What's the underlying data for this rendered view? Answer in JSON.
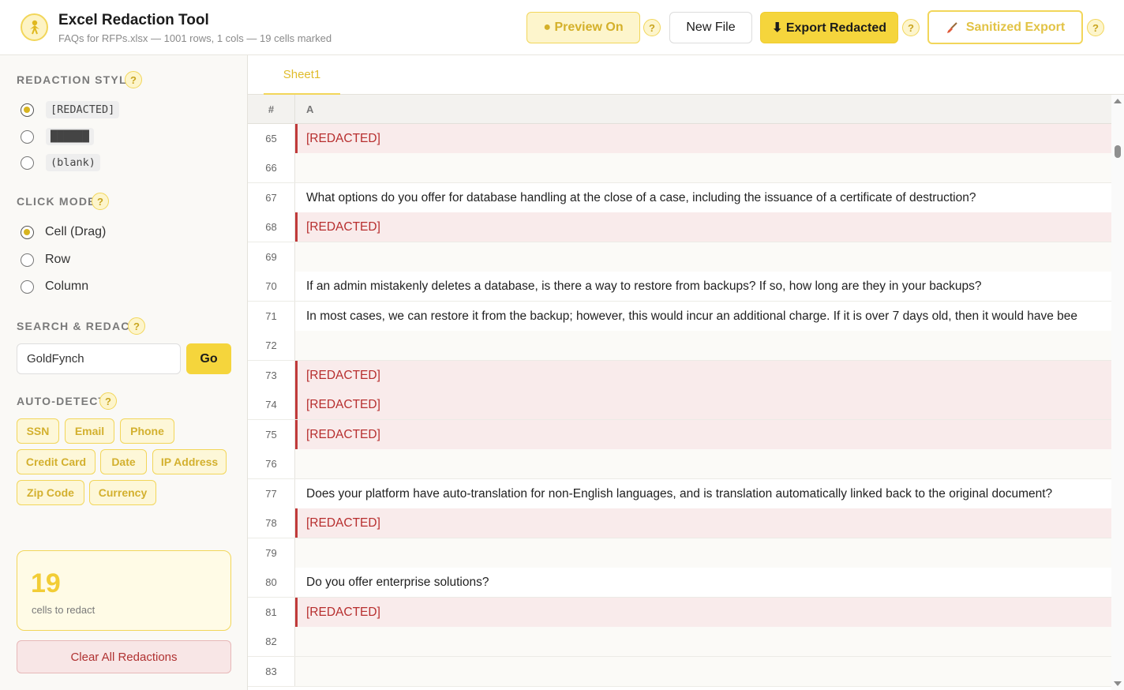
{
  "header": {
    "title": "Excel Redaction Tool",
    "subtitle": "FAQs for RFPs.xlsx — 1001 rows, 1 cols — 19 cells marked",
    "preview_label": "● Preview On",
    "new_file_label": "New File",
    "export_label": "⬇ Export Redacted",
    "sanitize_label": "Sanitized Export",
    "help_label": "?"
  },
  "sidebar": {
    "redaction_style": {
      "title": "REDACTION STYLE",
      "options": [
        "[REDACTED]",
        "██████",
        "(blank)"
      ]
    },
    "click_mode": {
      "title": "CLICK MODE",
      "options": [
        "Cell (Drag)",
        "Row",
        "Column"
      ]
    },
    "search": {
      "title": "SEARCH & REDACT",
      "value": "GoldFynch",
      "go_label": "Go"
    },
    "auto_detect": {
      "title": "AUTO-DETECT",
      "tags": [
        "SSN",
        "Email",
        "Phone",
        "Credit Card",
        "Date",
        "IP Address",
        "Zip Code",
        "Currency"
      ]
    },
    "count": {
      "value": "19",
      "label": "cells to redact"
    },
    "clear_label": "Clear All Redactions"
  },
  "main": {
    "tab": "Sheet1",
    "columns": {
      "num": "#",
      "a": "A"
    },
    "rows": [
      {
        "n": "65",
        "text": "[REDACTED]",
        "redacted": true
      },
      {
        "n": "66",
        "text": "",
        "redacted": false
      },
      {
        "n": "67",
        "text": "What options do you offer for database handling at the close of a case, including the issuance of a certificate of destruction?",
        "redacted": false
      },
      {
        "n": "68",
        "text": "[REDACTED]",
        "redacted": true
      },
      {
        "n": "69",
        "text": "",
        "redacted": false
      },
      {
        "n": "70",
        "text": "If an admin mistakenly deletes a database, is there a way to restore from backups? If so, how long are they in your backups?",
        "redacted": false
      },
      {
        "n": "71",
        "text": "In most cases, we can restore it from the backup; however, this would incur an additional charge. If it is over 7 days old, then it would have bee",
        "redacted": false
      },
      {
        "n": "72",
        "text": "",
        "redacted": false
      },
      {
        "n": "73",
        "text": "[REDACTED]",
        "redacted": true
      },
      {
        "n": "74",
        "text": "[REDACTED]",
        "redacted": true
      },
      {
        "n": "75",
        "text": "[REDACTED]",
        "redacted": true
      },
      {
        "n": "76",
        "text": "",
        "redacted": false
      },
      {
        "n": "77",
        "text": "Does your platform have auto-translation for non-English languages, and is translation automatically linked back to the original document?",
        "redacted": false
      },
      {
        "n": "78",
        "text": "[REDACTED]",
        "redacted": true
      },
      {
        "n": "79",
        "text": "",
        "redacted": false
      },
      {
        "n": "80",
        "text": "Do you offer enterprise solutions?",
        "redacted": false
      },
      {
        "n": "81",
        "text": "[REDACTED]",
        "redacted": true
      },
      {
        "n": "82",
        "text": "",
        "redacted": false
      },
      {
        "n": "83",
        "text": "",
        "redacted": false
      }
    ]
  },
  "icons": {
    "logo": "bird-logo-icon",
    "help": "help-icon",
    "sanitize": "broom-icon"
  },
  "colors": {
    "accent": "#f5d53c",
    "redacted_text": "#b72e2e",
    "redacted_bg": "#f9ebeb"
  }
}
